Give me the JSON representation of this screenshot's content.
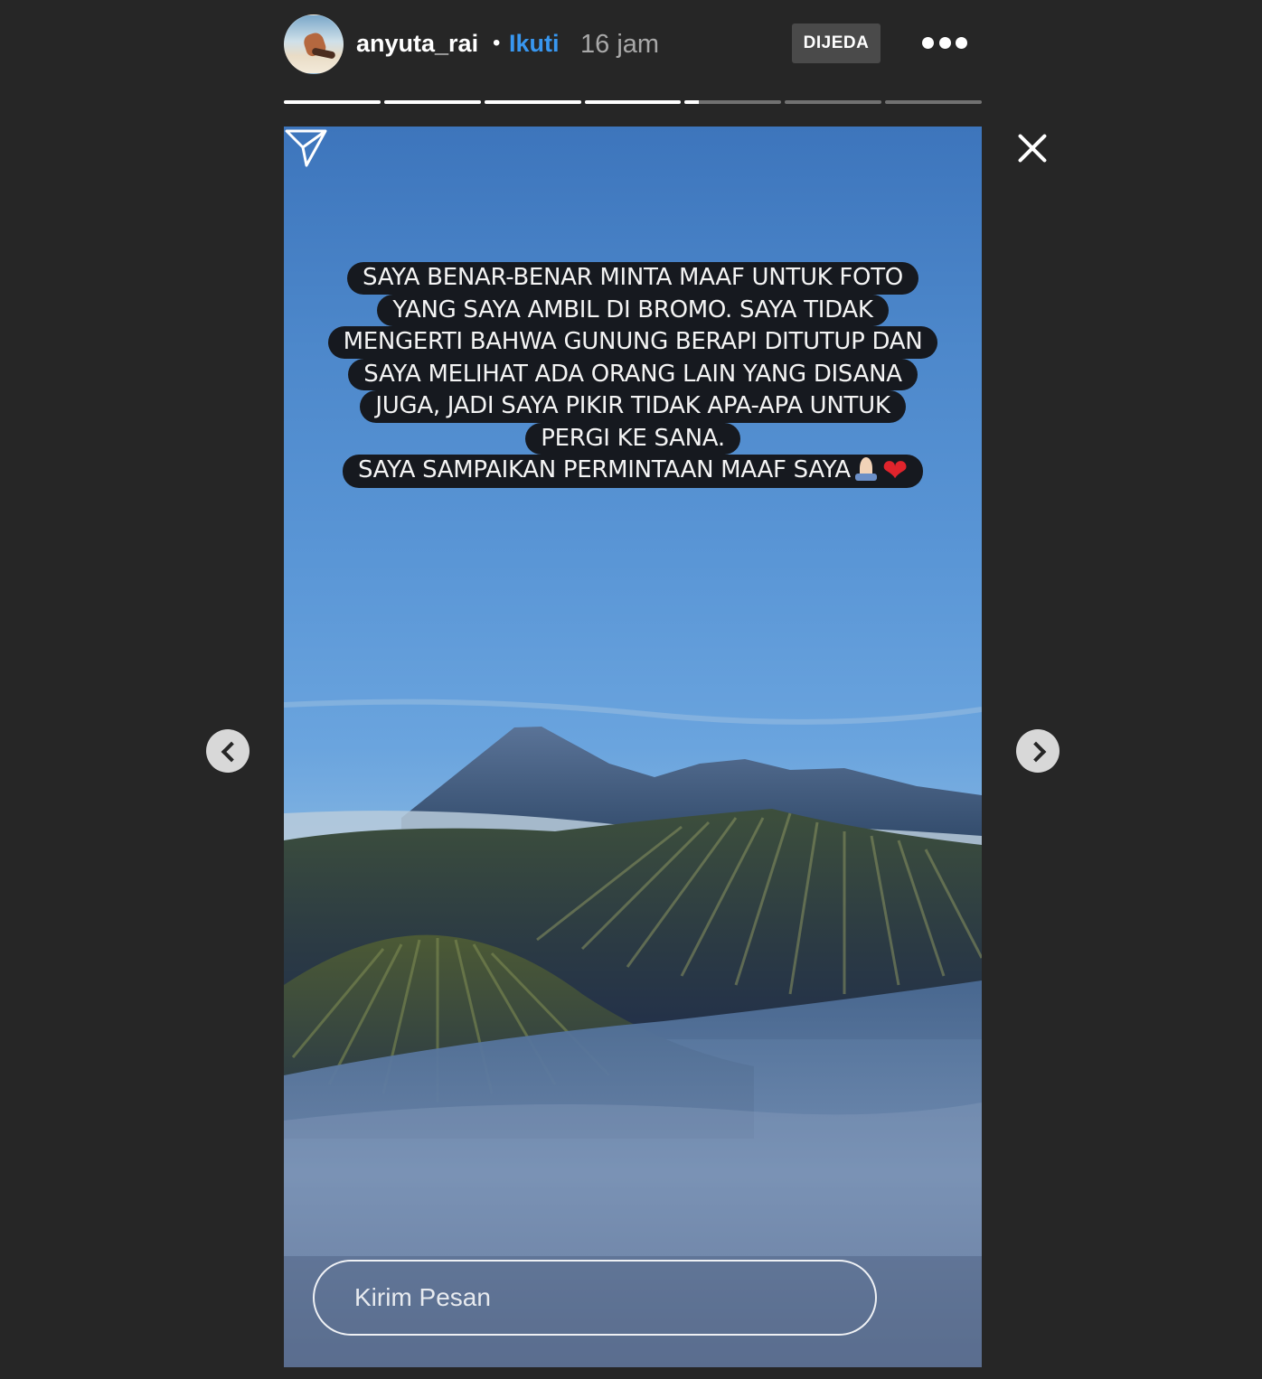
{
  "header": {
    "username": "anyuta_rai",
    "separator": "•",
    "follow_label": "Ikuti",
    "time_ago": "16 jam",
    "paused_label": "DIJEDA",
    "more_icon": "more-options-icon"
  },
  "progress": {
    "segments": [
      1,
      1,
      1,
      1,
      0.15,
      0,
      0
    ]
  },
  "story": {
    "caption_lines": [
      "SAYA BENAR-BENAR MINTA MAAF UNTUK FOTO",
      "YANG SAYA AMBIL DI BROMO. SAYA TIDAK",
      "MENGERTI BAHWA GUNUNG BERAPI DITUTUP DAN",
      "SAYA MELIHAT ADA ORANG LAIN YANG DISANA",
      "JUGA, JADI SAYA PIKIR TIDAK APA-APA UNTUK",
      "PERGI KE SANA."
    ],
    "caption_last": "SAYA SAMPAIKAN PERMINTAAN MAAF SAYA",
    "caption_emoji": [
      "folded-hands-emoji",
      "red-heart-emoji"
    ]
  },
  "reply": {
    "placeholder": "Kirim Pesan"
  },
  "colors": {
    "background": "#262626",
    "follow": "#3897f0",
    "caption_bg": "#16191f"
  },
  "icons": {
    "close": "close-icon",
    "prev": "chevron-left-icon",
    "next": "chevron-right-icon",
    "send": "paper-plane-icon"
  }
}
